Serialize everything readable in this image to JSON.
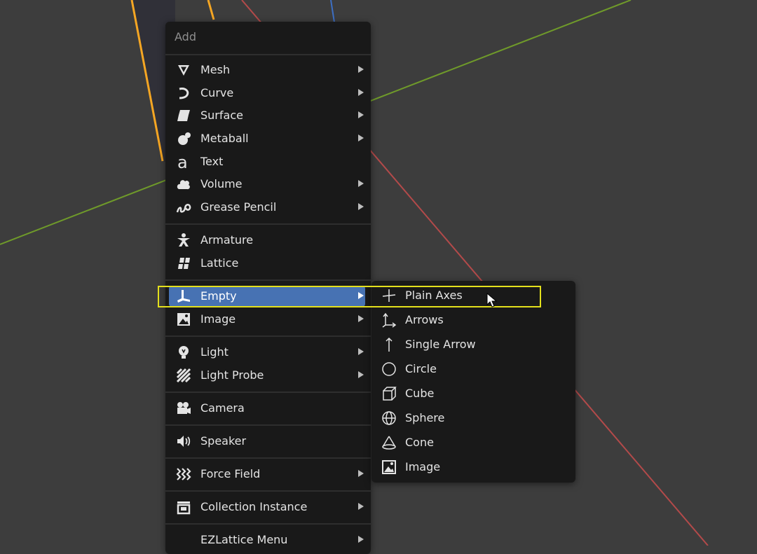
{
  "add_menu": {
    "title": "Add",
    "items": [
      {
        "label": "Mesh",
        "icon": "mesh-icon",
        "submenu": true
      },
      {
        "label": "Curve",
        "icon": "curve-icon",
        "submenu": true
      },
      {
        "label": "Surface",
        "icon": "surface-icon",
        "submenu": true
      },
      {
        "label": "Metaball",
        "icon": "metaball-icon",
        "submenu": true
      },
      {
        "label": "Text",
        "icon": "text-icon",
        "submenu": false
      },
      {
        "label": "Volume",
        "icon": "volume-icon",
        "submenu": true
      },
      {
        "label": "Grease Pencil",
        "icon": "grease-pencil-icon",
        "submenu": true
      },
      {
        "label": "Armature",
        "icon": "armature-icon",
        "submenu": false
      },
      {
        "label": "Lattice",
        "icon": "lattice-icon",
        "submenu": false
      },
      {
        "label": "Empty",
        "icon": "empty-icon",
        "submenu": true,
        "active": true
      },
      {
        "label": "Image",
        "icon": "image-icon",
        "submenu": true
      },
      {
        "label": "Light",
        "icon": "light-icon",
        "submenu": true
      },
      {
        "label": "Light Probe",
        "icon": "light-probe-icon",
        "submenu": true
      },
      {
        "label": "Camera",
        "icon": "camera-icon",
        "submenu": false
      },
      {
        "label": "Speaker",
        "icon": "speaker-icon",
        "submenu": false
      },
      {
        "label": "Force Field",
        "icon": "force-field-icon",
        "submenu": true
      },
      {
        "label": "Collection Instance",
        "icon": "collection-instance-icon",
        "submenu": true
      },
      {
        "label": "EZLattice Menu",
        "icon": "",
        "submenu": true
      }
    ]
  },
  "empty_submenu": {
    "items": [
      {
        "label": "Plain Axes",
        "icon": "plain-axes-icon"
      },
      {
        "label": "Arrows",
        "icon": "arrows-icon"
      },
      {
        "label": "Single Arrow",
        "icon": "single-arrow-icon"
      },
      {
        "label": "Circle",
        "icon": "circle-icon"
      },
      {
        "label": "Cube",
        "icon": "cube-icon"
      },
      {
        "label": "Sphere",
        "icon": "sphere-icon"
      },
      {
        "label": "Cone",
        "icon": "cone-icon"
      },
      {
        "label": "Image",
        "icon": "image-icon"
      }
    ]
  },
  "colors": {
    "viewport_bg": "#3d3d3d",
    "menu_bg": "#191919",
    "active_item": "#4772b3",
    "highlight_box": "#e3e01c",
    "selected_outline": "#f5a623",
    "x_axis": "#b34a4a",
    "y_axis": "#6f9a2a",
    "z_axis": "#3d6fc4"
  }
}
